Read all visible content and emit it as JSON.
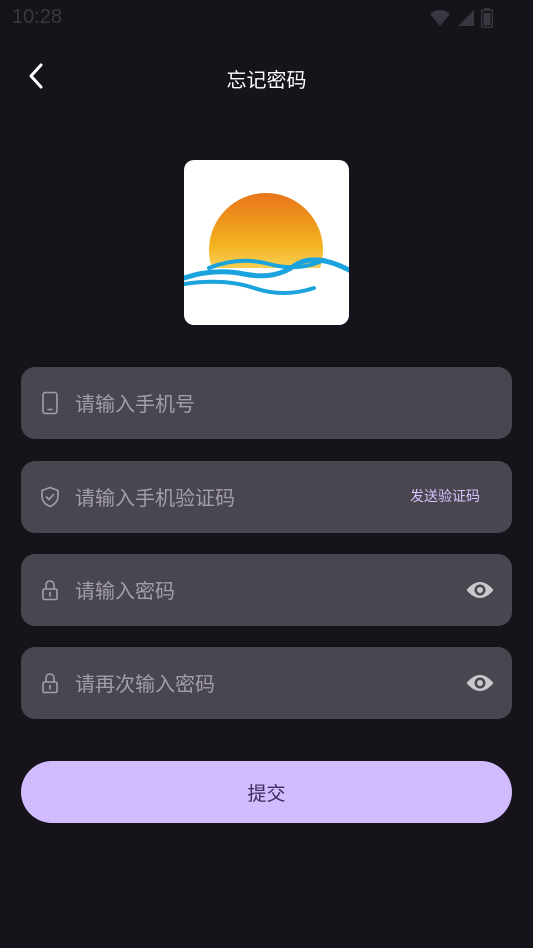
{
  "status_bar": {
    "time": "10:28",
    "icons": [
      "wifi-icon",
      "signal-icon",
      "battery-icon"
    ]
  },
  "header": {
    "back_icon": "chevron-left-icon",
    "title": "忘记密码"
  },
  "logo": {
    "icon": "sunset-waves-logo",
    "colors": {
      "sun_top": "#e8751a",
      "sun_bottom": "#fff6c2",
      "wave": "#1aa3dc"
    }
  },
  "form": {
    "phone": {
      "placeholder": "请输入手机号",
      "value": "",
      "icon": "phone-icon"
    },
    "code": {
      "placeholder": "请输入手机验证码",
      "value": "",
      "icon": "shield-icon",
      "send_label": "发送验证码"
    },
    "password": {
      "placeholder": "请输入密码",
      "value": "",
      "icon": "lock-icon",
      "toggle_icon": "eye-icon"
    },
    "confirm_password": {
      "placeholder": "请再次输入密码",
      "value": "",
      "icon": "lock-icon",
      "toggle_icon": "eye-icon"
    }
  },
  "submit": {
    "label": "提交"
  },
  "colors": {
    "background": "#16131b",
    "field_background": "#4a4650",
    "accent": "#d0bcff",
    "accent_text": "#d7c4ff"
  }
}
